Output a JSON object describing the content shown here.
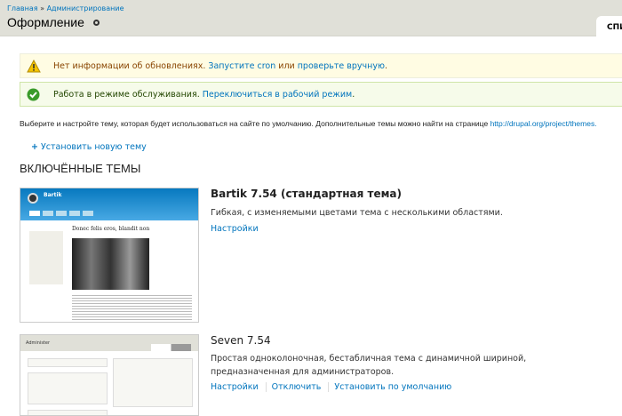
{
  "header": {
    "breadcrumb": [
      "Главная",
      "Администрирование"
    ],
    "breadcrumb_sep": "»",
    "title": "Оформление",
    "tab": "СПИ"
  },
  "messages": {
    "warning": {
      "text": "Нет информации об обновлениях.",
      "link1": "Запустите cron",
      "mid": "или",
      "link2": "проверьте вручную",
      "end": "."
    },
    "status": {
      "text": "Работа в режиме обслуживания.",
      "link": "Переключиться в рабочий режим",
      "end": "."
    }
  },
  "description": {
    "text": "Выберите и настройте тему, которая будет использоваться на сайте по умолчанию. Дополнительные темы можно найти на странице",
    "link": "http://drupal.org/project/themes."
  },
  "install_link": "Установить новую тему",
  "section_title": "ВКЛЮЧЁННЫЕ ТЕМЫ",
  "themes": [
    {
      "name": "Bartik 7.54 (стандартная тема)",
      "description": "Гибкая, с изменяемыми цветами тема с несколькими областями.",
      "links": [
        "Настройки"
      ],
      "thumb": {
        "site": "Bartik",
        "headline": "Donec felis eros, blandit non"
      }
    },
    {
      "name": "Seven 7.54",
      "description": "Простая одноколоночная, бестабличная тема с динамичной шириной, предназначенная для администраторов.",
      "links": [
        "Настройки",
        "Отключить",
        "Установить по умолчанию"
      ],
      "thumb": {
        "title": "Administer"
      }
    }
  ],
  "colors": {
    "link": "#0074bd",
    "header_bg": "#e0e0d8",
    "warning_bg": "#fffce3",
    "status_bg": "#f6fbea"
  }
}
